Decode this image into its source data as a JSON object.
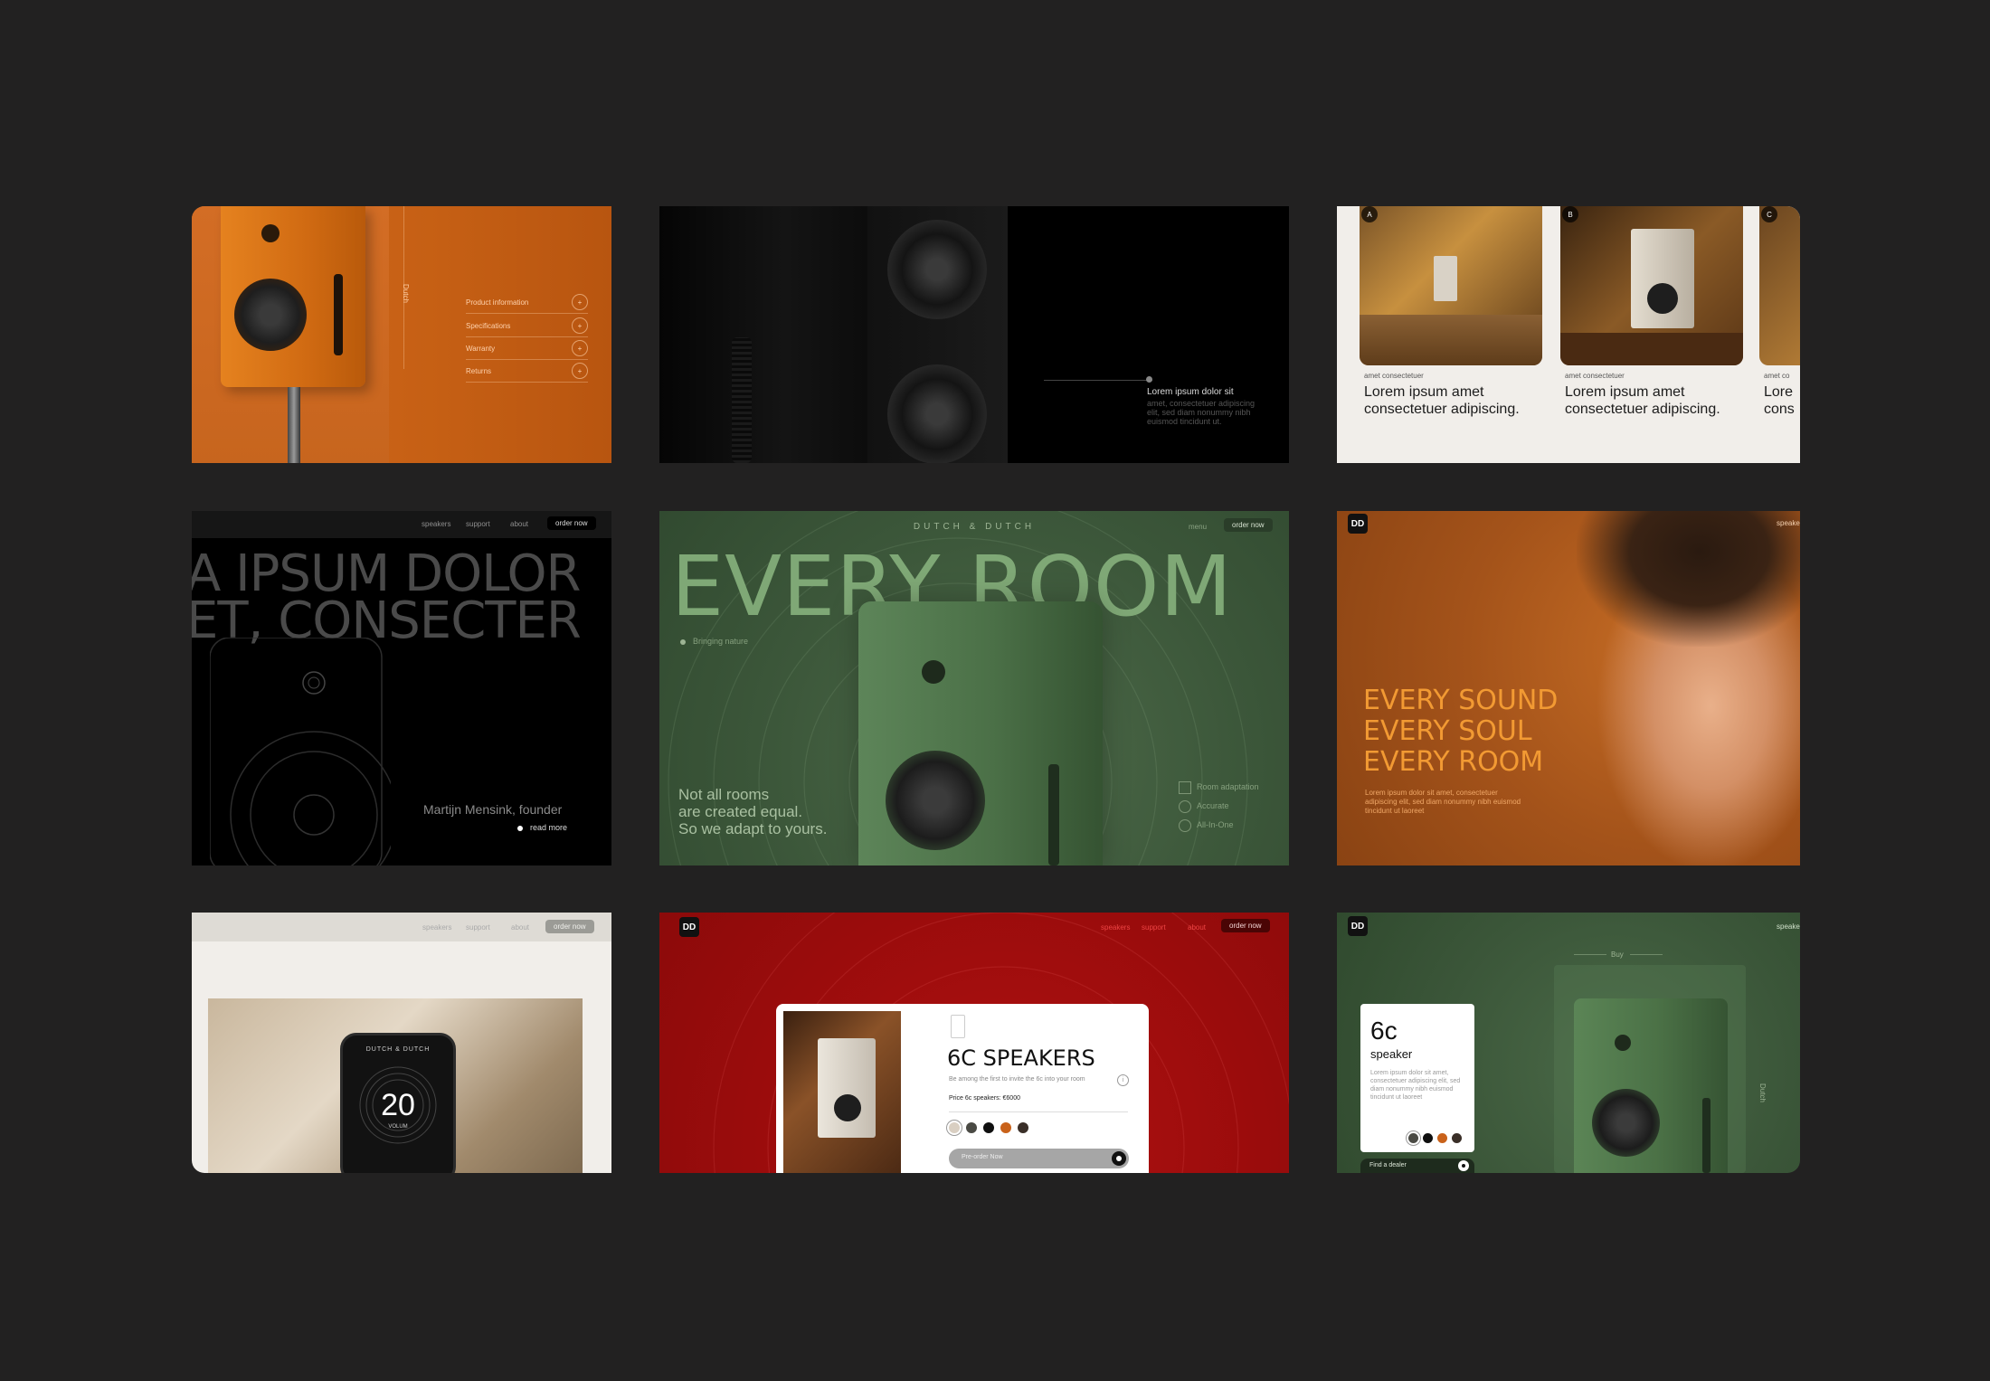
{
  "colors": {
    "background": "#222121",
    "orange": "#c9621a",
    "green": "#3f5a3d",
    "red": "#a00d0d",
    "cream": "#f1eeea"
  },
  "tile1": {
    "side_label": "Dutch",
    "menu": [
      {
        "label": "Product information",
        "icon": "+"
      },
      {
        "label": "Specifications",
        "icon": "+"
      },
      {
        "label": "Warranty",
        "icon": "+"
      },
      {
        "label": "Returns",
        "icon": "+"
      }
    ]
  },
  "tile2": {
    "title": "Lorem ipsum dolor sit",
    "body": "amet, consectetuer adipiscing elit, sed diam nonummy nibh euismod tincidunt ut."
  },
  "tile3": {
    "cards": [
      {
        "badge": "A",
        "label": "amet consectetuer",
        "headline": "Lorem ipsum amet consectetuer adipiscing."
      },
      {
        "badge": "B",
        "label": "amet consectetuer",
        "headline": "Lorem ipsum amet consectetuer adipiscing."
      },
      {
        "badge": "C",
        "label": "amet co",
        "headline": "Lore cons"
      }
    ]
  },
  "tile4": {
    "nav": [
      "speakers",
      "support",
      "about"
    ],
    "order": "order now",
    "headline_1": "A IPSUM DOLOR",
    "headline_2": "ET, CONSECTER",
    "founder": "Martijn Mensink, founder",
    "read_more": "read more"
  },
  "tile5": {
    "brand": "DUTCH & DUTCH",
    "menu": "menu",
    "order": "order now",
    "headline": "EVERY ROOM",
    "tag": "Bringing nature",
    "tagline_1": "Not all rooms",
    "tagline_2": "are created equal.",
    "tagline_3": "So we adapt to yours.",
    "features": [
      "Room adaptation",
      "Accurate",
      "All-In-One"
    ]
  },
  "tile6": {
    "logo": "DD",
    "nav": "speake",
    "line1": "EVERY SOUND",
    "line2": "EVERY SOUL",
    "line3": "EVERY ROOM",
    "body": "Lorem ipsum dolor sit amet, consectetuer adipiscing elit, sed diam nonummy nibh euismod tincidunt ut laoreet"
  },
  "tile7": {
    "nav": [
      "speakers",
      "support",
      "about"
    ],
    "order": "order now",
    "brand": "DUTCH & DUTCH",
    "volume": "20",
    "volume_label": "VOLUM"
  },
  "tile8": {
    "logo": "DD",
    "nav": [
      "speakers",
      "support",
      "about"
    ],
    "order": "order now",
    "title": "6C SPEAKERS",
    "subtitle": "Be among the first to invite the 6c into your room",
    "price": "Price 6c speakers: €6000",
    "cta": "Pre-order Now",
    "swatches": [
      "#d9cfc2",
      "#4a4a44",
      "#0f0f0f",
      "#c9621a",
      "#3a2f28"
    ]
  },
  "tile9": {
    "logo": "DD",
    "nav": "speake",
    "tab": "Buy",
    "side": "Dutch",
    "model": "6c",
    "model_sub": "speaker",
    "body": "Lorem ipsum dolor sit amet, consectetuer adipiscing elit, sed diam nonummy nibh euismod tincidunt ut laoreet",
    "cta": "Find a dealer",
    "swatches": [
      "#4a4a44",
      "#0f0f0f",
      "#c9621a",
      "#3a2f28"
    ]
  }
}
